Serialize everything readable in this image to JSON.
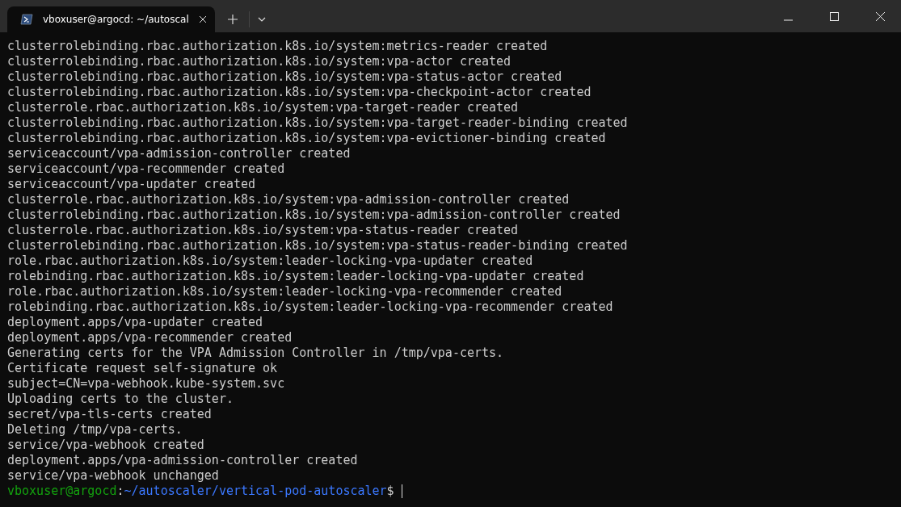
{
  "tab": {
    "title": "vboxuser@argocd: ~/autoscal",
    "selected": true
  },
  "output": [
    "clusterrolebinding.rbac.authorization.k8s.io/system:metrics-reader created",
    "clusterrolebinding.rbac.authorization.k8s.io/system:vpa-actor created",
    "clusterrolebinding.rbac.authorization.k8s.io/system:vpa-status-actor created",
    "clusterrolebinding.rbac.authorization.k8s.io/system:vpa-checkpoint-actor created",
    "clusterrole.rbac.authorization.k8s.io/system:vpa-target-reader created",
    "clusterrolebinding.rbac.authorization.k8s.io/system:vpa-target-reader-binding created",
    "clusterrolebinding.rbac.authorization.k8s.io/system:vpa-evictioner-binding created",
    "serviceaccount/vpa-admission-controller created",
    "serviceaccount/vpa-recommender created",
    "serviceaccount/vpa-updater created",
    "clusterrole.rbac.authorization.k8s.io/system:vpa-admission-controller created",
    "clusterrolebinding.rbac.authorization.k8s.io/system:vpa-admission-controller created",
    "clusterrole.rbac.authorization.k8s.io/system:vpa-status-reader created",
    "clusterrolebinding.rbac.authorization.k8s.io/system:vpa-status-reader-binding created",
    "role.rbac.authorization.k8s.io/system:leader-locking-vpa-updater created",
    "rolebinding.rbac.authorization.k8s.io/system:leader-locking-vpa-updater created",
    "role.rbac.authorization.k8s.io/system:leader-locking-vpa-recommender created",
    "rolebinding.rbac.authorization.k8s.io/system:leader-locking-vpa-recommender created",
    "deployment.apps/vpa-updater created",
    "deployment.apps/vpa-recommender created",
    "Generating certs for the VPA Admission Controller in /tmp/vpa-certs.",
    "Certificate request self-signature ok",
    "subject=CN=vpa-webhook.kube-system.svc",
    "Uploading certs to the cluster.",
    "secret/vpa-tls-certs created",
    "Deleting /tmp/vpa-certs.",
    "service/vpa-webhook created",
    "deployment.apps/vpa-admission-controller created",
    "service/vpa-webhook unchanged"
  ],
  "prompt": {
    "user_host": "vboxuser@argocd",
    "separator": ":",
    "path": "~/autoscaler/vertical-pod-autoscaler",
    "symbol": "$"
  }
}
